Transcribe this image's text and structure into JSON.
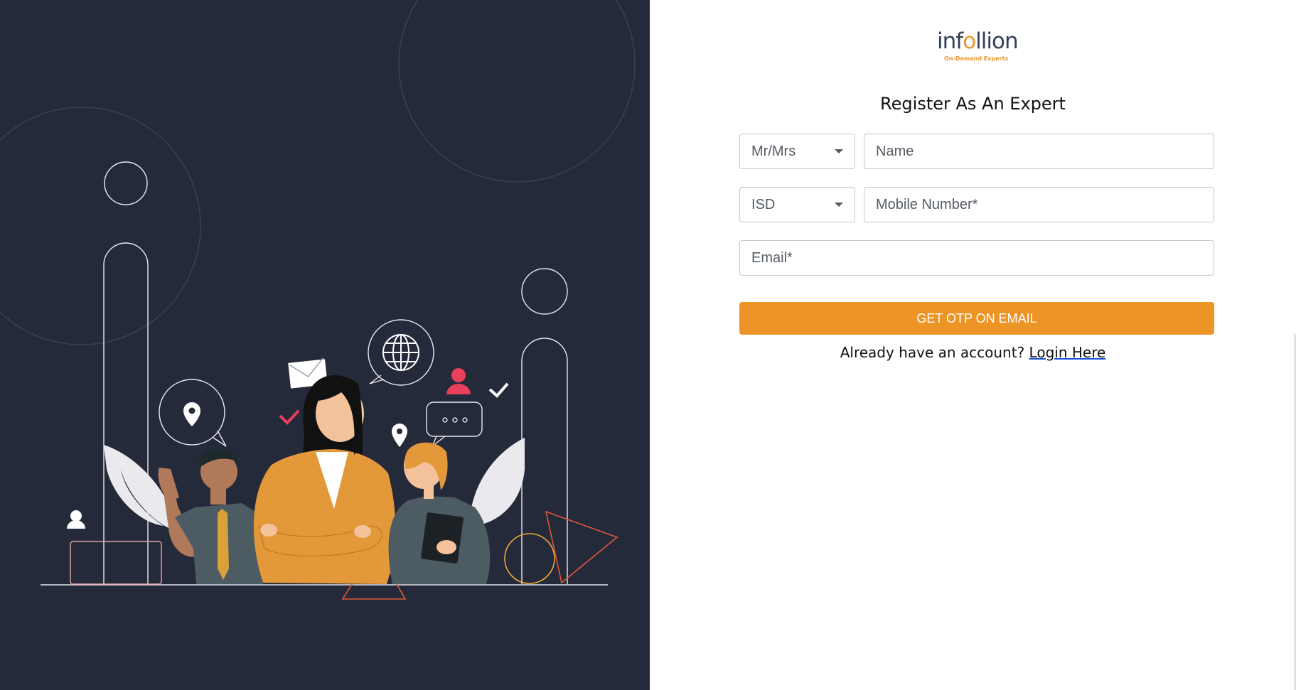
{
  "brand": {
    "logo_word_start": "inf",
    "logo_word_o": "o",
    "logo_word_end": "llion",
    "tagline": "On-Demand Experts",
    "accent_color": "#ec9526",
    "panel_color": "#252a3a"
  },
  "form": {
    "title": "Register As An Expert",
    "salutation": {
      "selected": "Mr/Mrs",
      "icon": "caret-down-icon"
    },
    "name_placeholder": "Name",
    "isd": {
      "selected": "ISD",
      "icon": "caret-down-icon"
    },
    "mobile_placeholder": "Mobile Number*",
    "email_placeholder": "Email*",
    "submit_label": "GET OTP ON EMAIL"
  },
  "footer": {
    "prompt": "Already have an account?",
    "login_link": "Login Here"
  }
}
